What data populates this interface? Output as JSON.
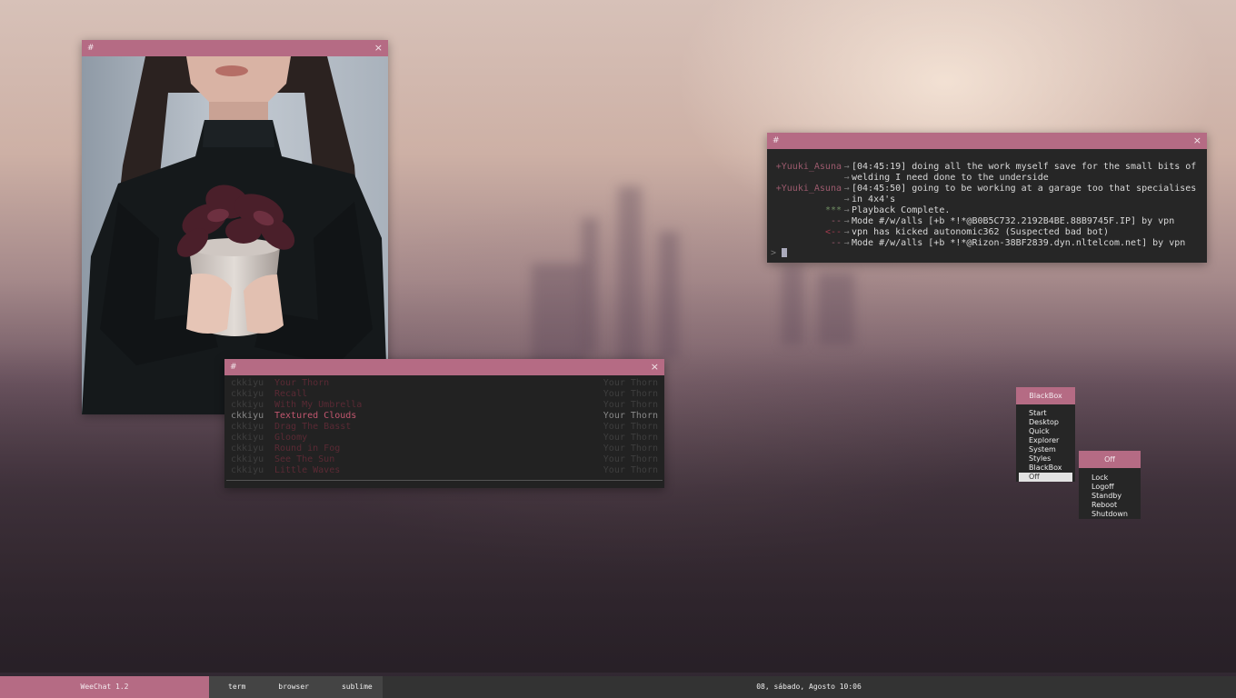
{
  "colors": {
    "accent": "#b56b84",
    "taskbar": "#333333",
    "window_bg": "#262626",
    "active_track": "#c0566e"
  },
  "photo_window": {
    "title": "#",
    "close": "×"
  },
  "irc_window": {
    "title": "#",
    "close": "×",
    "lines": [
      {
        "nick": "+Yuuki_Asuna",
        "sep": "→",
        "msg": "[04:45:19] doing all the work myself save for the small bits of"
      },
      {
        "nick": "",
        "sep": "→",
        "msg": "welding I need done to the underside"
      },
      {
        "nick": "+Yuuki_Asuna",
        "sep": "→",
        "msg": "[04:45:50] going to be working at a garage too that specialises"
      },
      {
        "nick": "",
        "sep": "→",
        "msg": "in 4x4's"
      },
      {
        "nick": "***",
        "sep": "→",
        "msg": "Playback Complete."
      },
      {
        "nick": "--",
        "sep": "→",
        "msg": "Mode #/w/alls [+b *!*@B0B5C732.2192B4BE.88B9745F.IP] by vpn"
      },
      {
        "nick": "<--",
        "sep": "→",
        "msg": "vpn has kicked autonomic362 (Suspected bad bot)"
      },
      {
        "nick": "--",
        "sep": "→",
        "msg": "Mode #/w/alls [+b *!*@Rizon-38BF2839.dyn.nltelcom.net] by vpn"
      }
    ],
    "prompt": ">"
  },
  "music_window": {
    "title": "#",
    "close": "×",
    "tracks": [
      {
        "artist": "ckkiyu",
        "title": "Your Thorn",
        "album": "Your Thorn"
      },
      {
        "artist": "ckkiyu",
        "title": "Recall",
        "album": "Your Thorn"
      },
      {
        "artist": "ckkiyu",
        "title": "With My Umbrella",
        "album": "Your Thorn"
      },
      {
        "artist": "ckkiyu",
        "title": "Textured Clouds",
        "album": "Your Thorn"
      },
      {
        "artist": "ckkiyu",
        "title": "Drag The Basst",
        "album": "Your Thorn"
      },
      {
        "artist": "ckkiyu",
        "title": "Gloomy",
        "album": "Your Thorn"
      },
      {
        "artist": "ckkiyu",
        "title": "Round in Fog",
        "album": "Your Thorn"
      },
      {
        "artist": "ckkiyu",
        "title": "See The Sun",
        "album": "Your Thorn"
      },
      {
        "artist": "ckkiyu",
        "title": "Little Waves",
        "album": "Your Thorn"
      }
    ],
    "active_index": 3
  },
  "blackbox_menu": {
    "title": "BlackBox",
    "items": [
      "Start",
      "Desktop",
      "Quick",
      "Explorer",
      "System",
      "Styles",
      "BlackBox",
      "Off"
    ],
    "selected": "Off"
  },
  "off_menu": {
    "title": "Off",
    "items": [
      "Lock",
      "Logoff",
      "Standby",
      "Reboot",
      "Shutdown"
    ]
  },
  "taskbar": {
    "title": "WeeChat 1.2",
    "tasks": [
      "term",
      "browser",
      "sublime"
    ],
    "clock": "08, sábado, Agosto 10:06"
  }
}
